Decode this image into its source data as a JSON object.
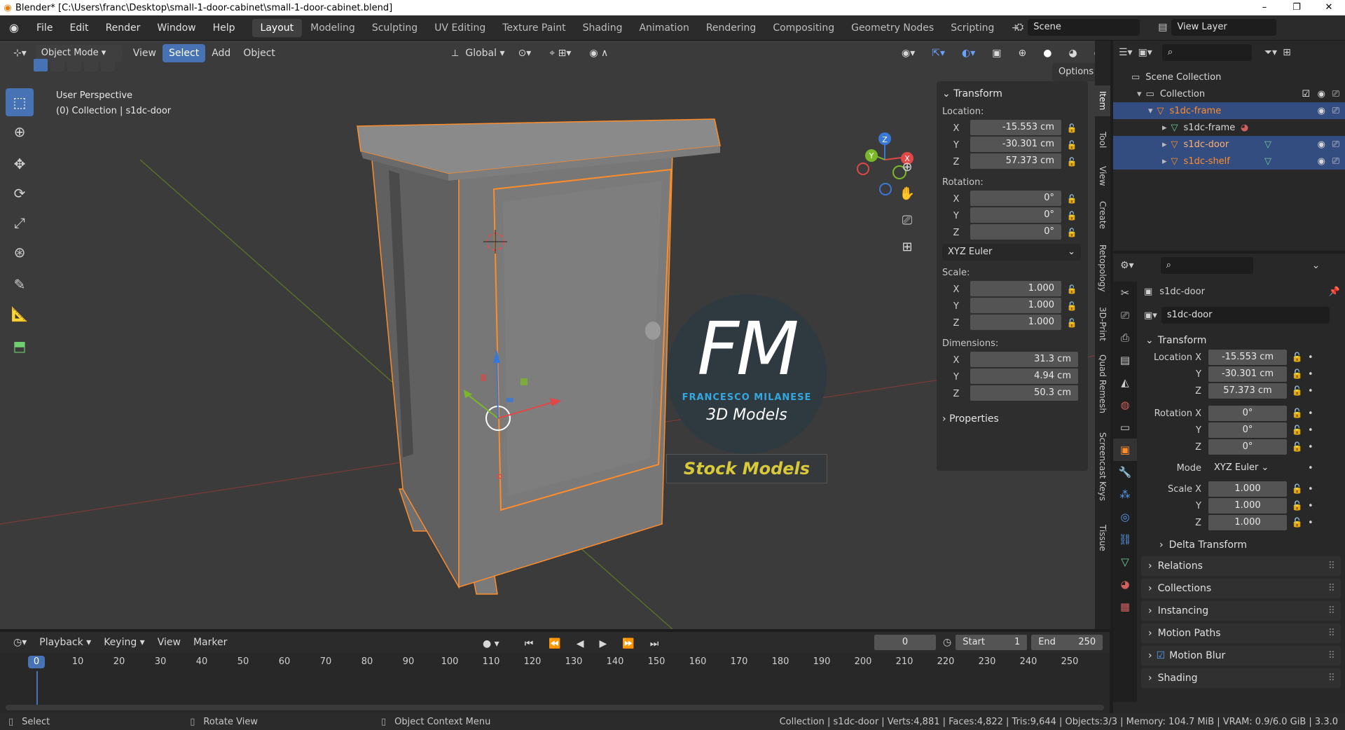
{
  "window": {
    "title": "Blender* [C:\\Users\\franc\\Desktop\\small-1-door-cabinet\\small-1-door-cabinet.blend]",
    "min": "–",
    "max": "❐",
    "close": "✕"
  },
  "menu": [
    "File",
    "Edit",
    "Render",
    "Window",
    "Help"
  ],
  "workspaces": [
    "Layout",
    "Modeling",
    "Sculpting",
    "UV Editing",
    "Texture Paint",
    "Shading",
    "Animation",
    "Rendering",
    "Compositing",
    "Geometry Nodes",
    "Scripting"
  ],
  "add_workspace": "+",
  "scene": "Scene",
  "view_layer": "View Layer",
  "viewport": {
    "mode": "Object Mode",
    "menus": [
      "View",
      "Select",
      "Add",
      "Object"
    ],
    "orientation": "Global",
    "options": "Options",
    "perspective": "User Perspective",
    "collection_info": "(0) Collection | s1dc-door",
    "gizmo_axes": [
      "X",
      "Y",
      "Z"
    ]
  },
  "npanel": {
    "title": "Transform",
    "location_label": "Location:",
    "location": [
      {
        "axis": "X",
        "value": "-15.553 cm"
      },
      {
        "axis": "Y",
        "value": "-30.301 cm"
      },
      {
        "axis": "Z",
        "value": "57.373 cm"
      }
    ],
    "rotation_label": "Rotation:",
    "rotation": [
      {
        "axis": "X",
        "value": "0°"
      },
      {
        "axis": "Y",
        "value": "0°"
      },
      {
        "axis": "Z",
        "value": "0°"
      }
    ],
    "rotation_mode": "XYZ Euler",
    "scale_label": "Scale:",
    "scale": [
      {
        "axis": "X",
        "value": "1.000"
      },
      {
        "axis": "Y",
        "value": "1.000"
      },
      {
        "axis": "Z",
        "value": "1.000"
      }
    ],
    "dimensions_label": "Dimensions:",
    "dimensions": [
      {
        "axis": "X",
        "value": "31.3 cm"
      },
      {
        "axis": "Y",
        "value": "4.94 cm"
      },
      {
        "axis": "Z",
        "value": "50.3 cm"
      }
    ],
    "properties": "Properties"
  },
  "side_tabs": [
    "Item",
    "Tool",
    "View",
    "Create",
    "Retopology",
    "3D-Print",
    "Quad Remesh",
    "Screencast Keys",
    "Tissue"
  ],
  "watermark": {
    "letters": "FM",
    "name": "FRANCESCO MILANESE",
    "sub": "3D Models",
    "banner": "Stock Models"
  },
  "outliner": {
    "root": "Scene Collection",
    "collection": "Collection",
    "items": [
      {
        "name": "s1dc-frame",
        "depth": 2
      },
      {
        "name": "s1dc-frame",
        "depth": 3
      },
      {
        "name": "s1dc-door",
        "depth": 3
      },
      {
        "name": "s1dc-shelf",
        "depth": 3
      }
    ]
  },
  "properties": {
    "object_name": "s1dc-door",
    "data_name": "s1dc-door",
    "transform_title": "Transform",
    "location_x_label": "Location X",
    "rotation_x_label": "Rotation X",
    "scale_x_label": "Scale X",
    "y_label": "Y",
    "z_label": "Z",
    "location": [
      "-15.553 cm",
      "-30.301 cm",
      "57.373 cm"
    ],
    "rotation": [
      "0°",
      "0°",
      "0°"
    ],
    "mode_label": "Mode",
    "mode": "XYZ Euler",
    "scale": [
      "1.000",
      "1.000",
      "1.000"
    ],
    "delta": "Delta Transform",
    "sections": [
      "Relations",
      "Collections",
      "Instancing",
      "Motion Paths",
      "Motion Blur",
      "Shading"
    ]
  },
  "timeline": {
    "menus": [
      "Playback",
      "Keying",
      "View",
      "Marker"
    ],
    "current_frame": "0",
    "start_label": "Start",
    "start": "1",
    "end_label": "End",
    "end": "250",
    "ticks": [
      "0",
      "10",
      "20",
      "30",
      "40",
      "50",
      "60",
      "70",
      "80",
      "90",
      "100",
      "110",
      "120",
      "130",
      "140",
      "150",
      "160",
      "170",
      "180",
      "190",
      "200",
      "210",
      "220",
      "230",
      "240",
      "250"
    ]
  },
  "status": {
    "select": "Select",
    "rotate": "Rotate View",
    "context": "Object Context Menu",
    "stats": "Collection | s1dc-door | Verts:4,881 | Faces:4,822 | Tris:9,644 | Objects:3/3 | Memory: 104.7 MiB | VRAM: 0.9/6.0 GiB | 3.3.0"
  },
  "colors": {
    "accent": "#4772b3",
    "selection": "#ff8c2a",
    "frame_marker": "#4772b3",
    "watermark_blue": "#35a7e0",
    "banner_text": "#d8c93a"
  }
}
